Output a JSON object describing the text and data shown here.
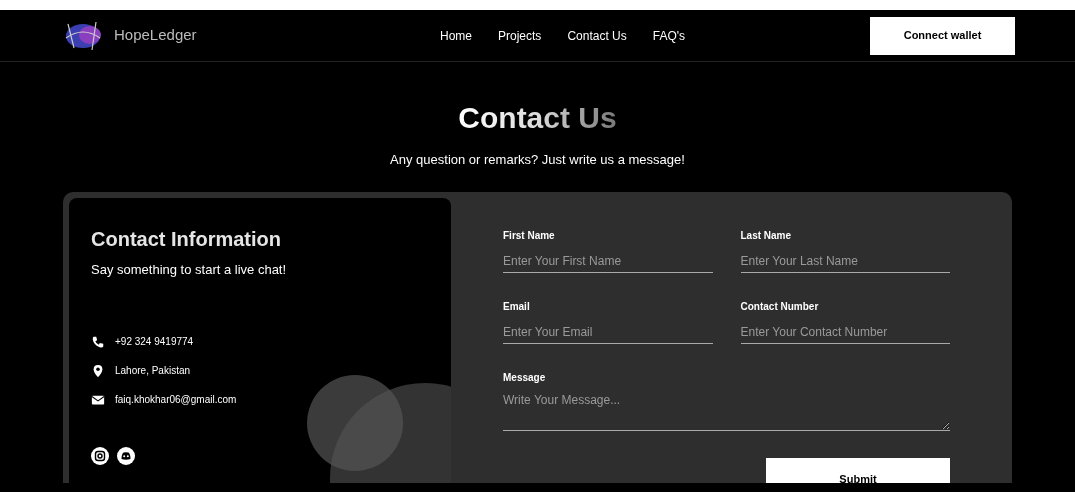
{
  "nav": {
    "brand": "HopeLedger",
    "links": [
      {
        "label": "Home"
      },
      {
        "label": "Projects"
      },
      {
        "label": "Contact Us"
      },
      {
        "label": "FAQ's"
      }
    ],
    "button": "Connect wallet"
  },
  "header": {
    "title": "Contact Us",
    "subtitle": "Any question or remarks? Just write us a message!"
  },
  "info": {
    "title": "Contact Information",
    "subtitle": "Say something to start a live chat!",
    "items": [
      {
        "kind": "phone",
        "text": "+92 324 9419774"
      },
      {
        "kind": "location",
        "text": "Lahore, Pakistan"
      },
      {
        "kind": "email",
        "text": "faiq.khokhar06@gmail.com"
      }
    ],
    "socials": [
      {
        "kind": "instagram"
      },
      {
        "kind": "discord"
      }
    ]
  },
  "form": {
    "fields": [
      {
        "label": "First Name",
        "placeholder": "Enter Your First Name"
      },
      {
        "label": "Last Name",
        "placeholder": "Enter Your Last Name"
      },
      {
        "label": "Email",
        "placeholder": "Enter Your Email"
      },
      {
        "label": "Contact Number",
        "placeholder": "Enter Your Contact Number"
      }
    ],
    "message": {
      "label": "Message",
      "placeholder": "Write Your Message..."
    },
    "submit": "Submit"
  }
}
